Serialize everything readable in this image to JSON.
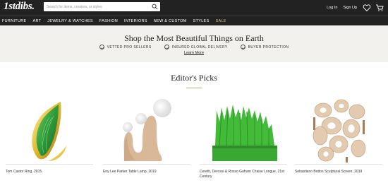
{
  "header": {
    "logo": "1stdibs.",
    "search_placeholder": "Search for items, creators, or styles",
    "login_label": "Log In",
    "signup_label": "Sign Up",
    "icons": [
      "search-icon",
      "heart-icon",
      "cart-icon"
    ]
  },
  "nav": {
    "items": [
      "FURNITURE",
      "ART",
      "JEWELRY & WATCHES",
      "FASHION",
      "INTERIORS",
      "NEW & CUSTOM",
      "STYLES",
      "SALE"
    ]
  },
  "banner": {
    "title": "Shop the Most Beautiful Things on Earth",
    "benefits": [
      "VETTED PRO SELLERS",
      "INSURED GLOBAL DELIVERY",
      "BUYER PROTECTION"
    ],
    "learn_more": "Learn More"
  },
  "picks": {
    "title": "Editor's Picks",
    "items": [
      {
        "caption": "Tom Castor Ring, 2015"
      },
      {
        "caption": "Eny Lee Parker Table Lamp, 2019"
      },
      {
        "caption": "Ceretti, Derossi & Rosso Gufram Chaise Longue, 21st Century"
      },
      {
        "caption": "Sebastiano Bottos Sculptural Screen, 2019"
      }
    ]
  },
  "colors": {
    "header_bg": "#222222",
    "banner_bg": "#f3f1ed",
    "accent_gold": "#c7a96b",
    "sale": "#d7c67a",
    "emerald": "#2f9a3a",
    "gufram_green": "#3bb235"
  }
}
